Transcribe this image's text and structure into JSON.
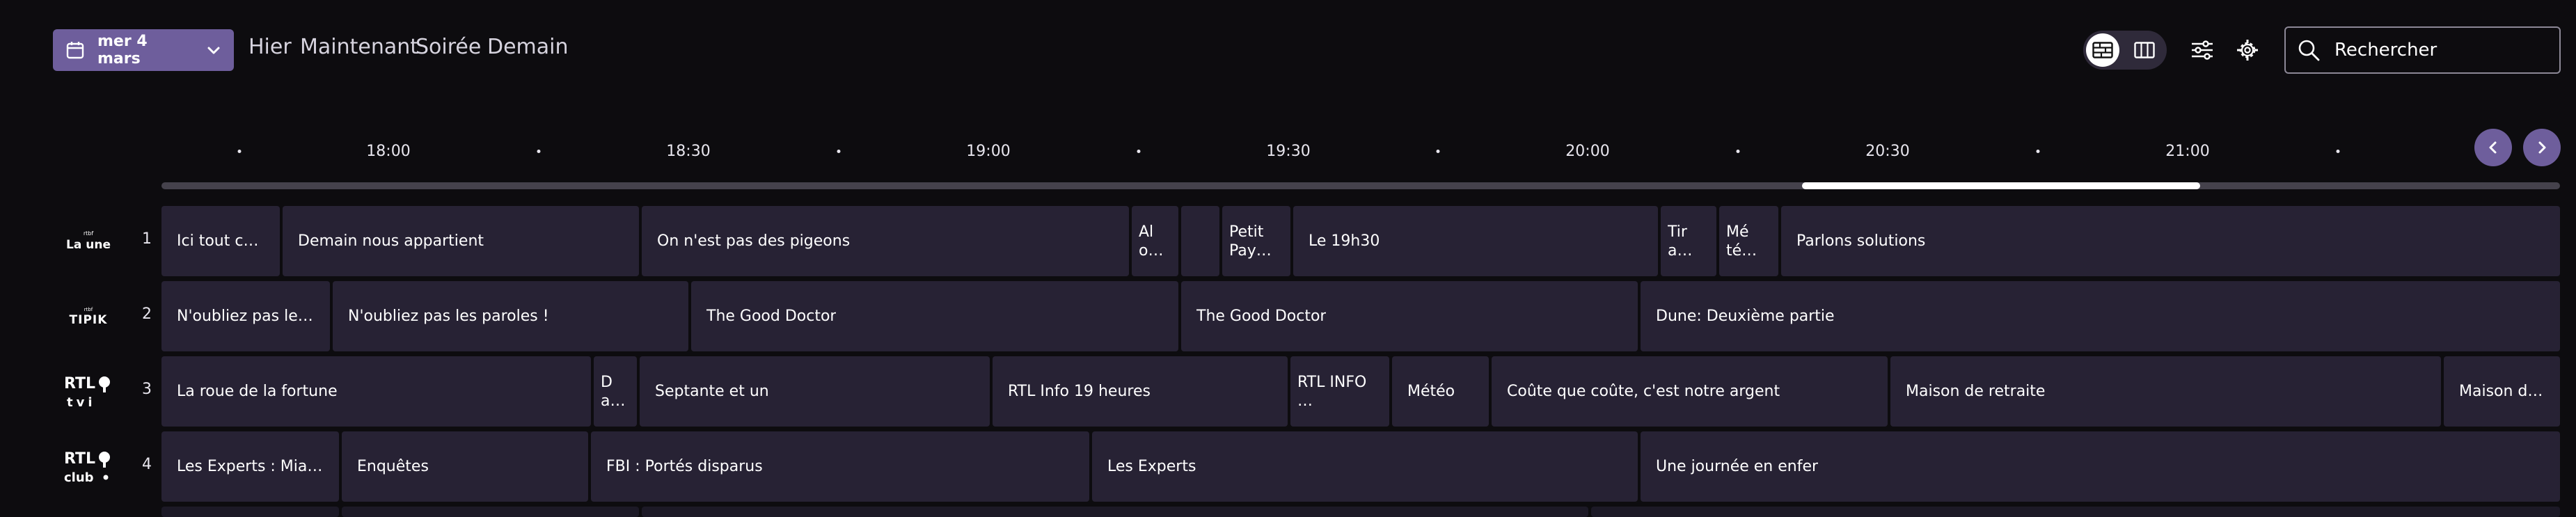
{
  "header": {
    "date_label": "mer 4 mars",
    "nav": [
      "Hier",
      "Maintenant",
      "Soirée",
      "Demain"
    ],
    "search_placeholder": "Rechercher"
  },
  "timeline": {
    "labels": [
      "18:00",
      "18:30",
      "19:00",
      "19:30",
      "20:00",
      "20:30",
      "21:00"
    ],
    "scroll_position": 0.82
  },
  "channels": [
    {
      "number": "1",
      "logo": "La une",
      "programs": [
        "Ici tout commence",
        "Demain nous appartient",
        "On n'est pas des pigeons",
        "Al o…",
        "",
        "Petit Pay…",
        "Le 19h30",
        "Tir a…",
        "Mé té…",
        "Parlons solutions"
      ]
    },
    {
      "number": "2",
      "logo": "TIPIK",
      "programs": [
        "N'oubliez pas les paroles !",
        "N'oubliez pas les paroles !",
        "The Good Doctor",
        "The Good Doctor",
        "Dune: Deuxième partie"
      ]
    },
    {
      "number": "3",
      "logo": "RTL tvi",
      "programs": [
        "La roue de la fortune",
        "D a…",
        "Septante et un",
        "RTL Info 19 heures",
        "RTL INFO …",
        "Météo",
        "Coûte que coûte, c'est notre argent",
        "Maison de retraite",
        "Maison de retraite"
      ]
    },
    {
      "number": "4",
      "logo": "RTL club",
      "programs": [
        "Les Experts : Miami",
        "Enquêtes",
        "FBI : Portés disparus",
        "Les Experts",
        "Une journée en enfer"
      ]
    }
  ],
  "colors": {
    "accent": "#6e5e9c",
    "tile": "#272234",
    "background": "#0d0c0f"
  }
}
